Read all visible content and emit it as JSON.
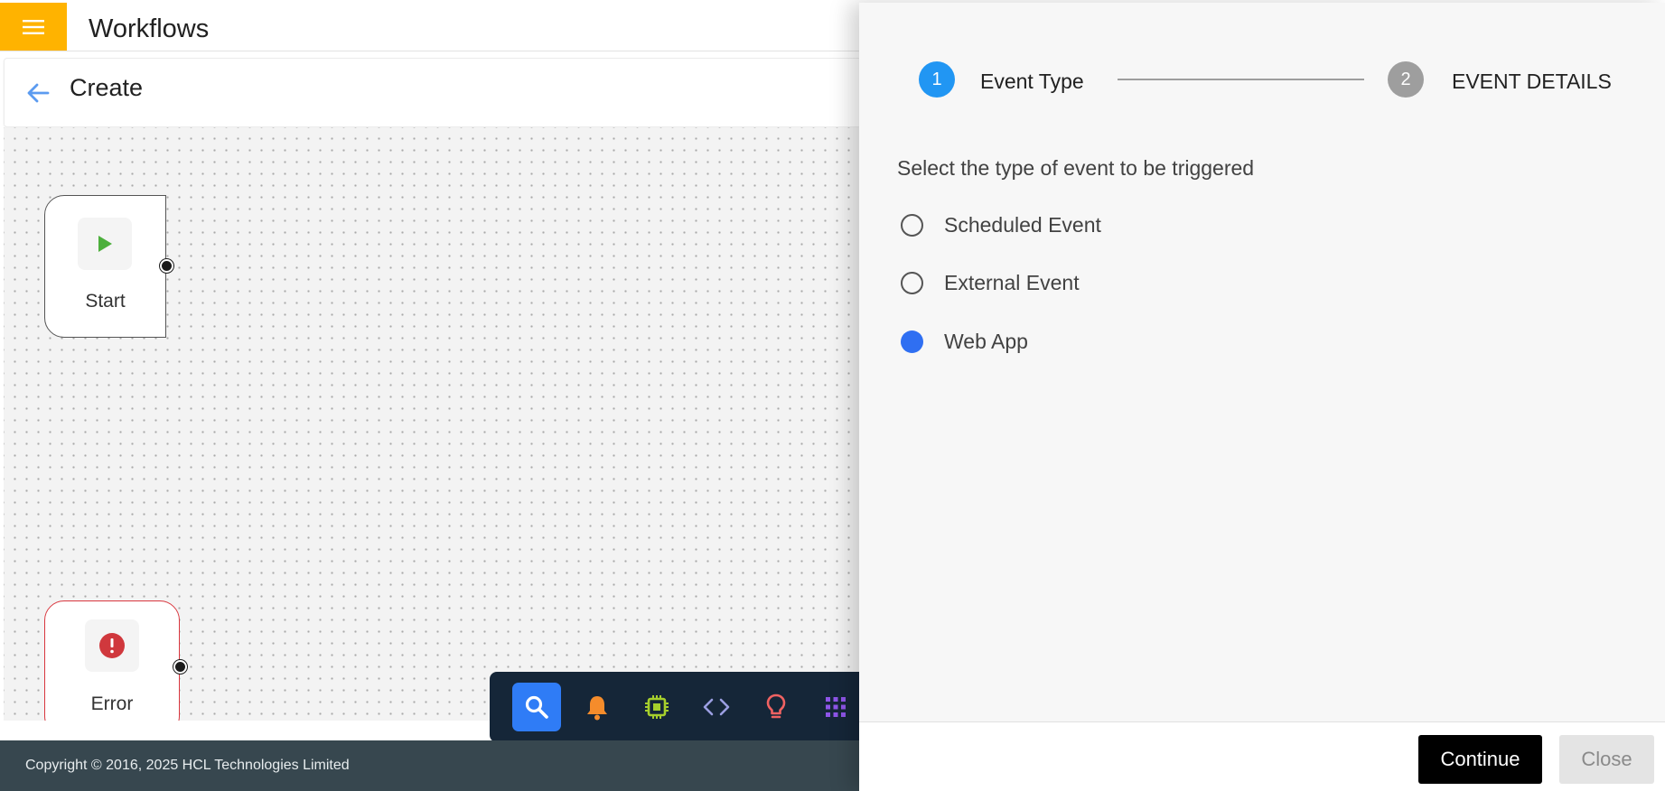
{
  "header": {
    "title": "Workflows",
    "menu_icon": "hamburger-menu-icon"
  },
  "subheader": {
    "title": "Create",
    "back_icon": "arrow-left-icon"
  },
  "canvas": {
    "nodes": [
      {
        "label": "Start",
        "icon": "play-icon"
      },
      {
        "label": "Error",
        "icon": "error-alert-icon"
      }
    ]
  },
  "toolbar": {
    "tools": [
      {
        "icon": "search-icon",
        "active": true,
        "color": "#ffffff"
      },
      {
        "icon": "bell-icon",
        "active": false,
        "color": "#f58c2b"
      },
      {
        "icon": "chip-icon",
        "active": false,
        "color": "#a6cf2c"
      },
      {
        "icon": "code-icon",
        "active": false,
        "color": "#9b9fe2"
      },
      {
        "icon": "lightbulb-icon",
        "active": false,
        "color": "#f06262"
      },
      {
        "icon": "apps-grid-icon",
        "active": false,
        "color": "#8e55e8"
      }
    ]
  },
  "footer": {
    "copyright": "Copyright © 2016, 2025 HCL Technologies Limited"
  },
  "panel": {
    "steps": [
      {
        "number": "1",
        "label": "Event Type",
        "active": true
      },
      {
        "number": "2",
        "label": "EVENT DETAILS",
        "active": false
      }
    ],
    "prompt": "Select the type of event to be triggered",
    "options": [
      {
        "label": "Scheduled Event",
        "checked": false
      },
      {
        "label": "External Event",
        "checked": false
      },
      {
        "label": "Web App",
        "checked": true
      }
    ],
    "continue_label": "Continue",
    "close_label": "Close"
  },
  "colors": {
    "menu_button": "#ffb300",
    "step_active": "#2196f3",
    "step_inactive": "#9e9e9e",
    "radio_checked": "#2f6ff2",
    "toolbar_bg": "#152638",
    "footer_bg": "#37474f",
    "error_border": "#d9363e"
  }
}
